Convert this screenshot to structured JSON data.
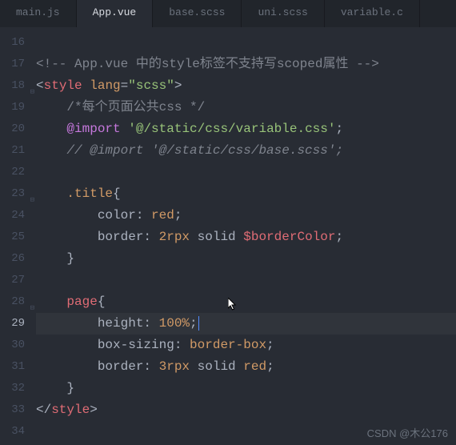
{
  "tabs": [
    {
      "label": "main.js",
      "active": false
    },
    {
      "label": "App.vue",
      "active": true
    },
    {
      "label": "base.scss",
      "active": false
    },
    {
      "label": "uni.scss",
      "active": false
    },
    {
      "label": "variable.c",
      "active": false
    }
  ],
  "gutter": {
    "start": 16,
    "end": 34,
    "current": 29,
    "foldable": [
      18,
      23,
      28
    ]
  },
  "code": {
    "l16": "",
    "l17_open": "<!-- ",
    "l17_mid": "App.vue 中的style标签不支持写scoped属性 ",
    "l17_close": "-->",
    "l18_b1": "<",
    "l18_tag": "style",
    "l18_attr": "lang",
    "l18_eq": "=",
    "l18_val": "\"scss\"",
    "l18_b2": ">",
    "l19": "/*每个页面公共css */",
    "l20_kw": "@import",
    "l20_str": "'@/static/css/variable.css'",
    "l20_sc": ";",
    "l21": "// @import '@/static/css/base.scss';",
    "l22": "",
    "l23_sel": ".title",
    "l23_brace": "{",
    "l24_prop": "color",
    "l24_colon": ": ",
    "l24_val": "red",
    "l24_sc": ";",
    "l25_prop": "border",
    "l25_colon": ": ",
    "l25_num": "2rpx",
    "l25_solid": " solid ",
    "l25_var": "$borderColor",
    "l25_sc": ";",
    "l26_brace": "}",
    "l27": "",
    "l28_sel": "page",
    "l28_brace": "{",
    "l29_prop": "height",
    "l29_colon": ": ",
    "l29_val": "100%",
    "l29_sc": ";",
    "l30_prop": "box-sizing",
    "l30_colon": ": ",
    "l30_val": "border-box",
    "l30_sc": ";",
    "l31_prop": "border",
    "l31_colon": ": ",
    "l31_num": "3rpx",
    "l31_solid": " solid ",
    "l31_val": "red",
    "l31_sc": ";",
    "l32_brace": "}",
    "l33_b1": "</",
    "l33_tag": "style",
    "l33_b2": ">",
    "l34": ""
  },
  "watermark": "CSDN @木公176"
}
